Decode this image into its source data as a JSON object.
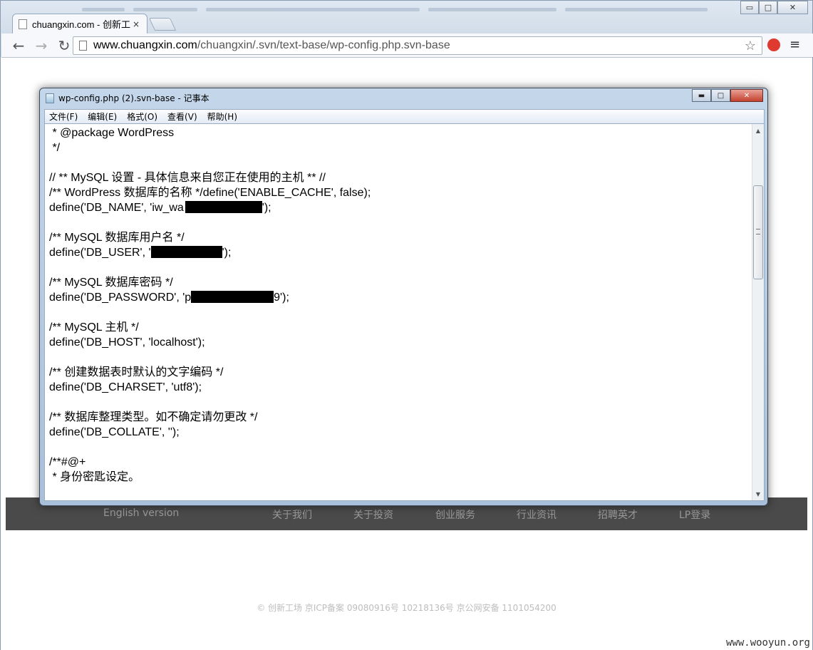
{
  "browser": {
    "tab_title": "chuangxin.com - 创新工",
    "tab_close": "×",
    "url_host": "www.chuangxin.com",
    "url_path": "/chuangxin/.svn/text-base/wp-config.php.svn-base",
    "back_glyph": "←",
    "forward_glyph": "→",
    "reload_glyph": "↻",
    "star_glyph": "☆",
    "menu_glyph": "≡",
    "min_glyph": "▭",
    "max_glyph": "□",
    "close_glyph": "✕"
  },
  "notepad": {
    "title": "wp-config.php (2).svn-base - 记事本",
    "min_glyph": "▬",
    "max_glyph": "□",
    "close_glyph": "✕",
    "menu": [
      "文件(F)",
      "编辑(E)",
      "格式(O)",
      "查看(V)",
      "帮助(H)"
    ],
    "lines": [
      " * @package WordPress",
      " */",
      "",
      "// ** MySQL 设置 - 具体信息来自您正在使用的主机 ** //",
      "/** WordPress 数据库的名称 */define('ENABLE_CACHE', false);",
      "define('DB_NAME', 'iw_wa",
      "",
      "/** MySQL 数据库用户名 */",
      "define('DB_USER', '",
      "",
      "/** MySQL 数据库密码 */",
      "define('DB_PASSWORD', 'p",
      "",
      "/** MySQL 主机 */",
      "define('DB_HOST', 'localhost');",
      "",
      "/** 创建数据表时默认的文字编码 */",
      "define('DB_CHARSET', 'utf8');",
      "",
      "/** 数据库整理类型。如不确定请勿更改 */",
      "define('DB_COLLATE', '');",
      "",
      "/**#@+",
      " * 身份密匙设定。"
    ],
    "line_tails": {
      "db_name": "');",
      "db_user": "');",
      "db_password": "9');"
    },
    "scroll_up": "▲",
    "scroll_down": "▼"
  },
  "page": {
    "footer_links": [
      "English version",
      "关于我们",
      "关于投资",
      "创业服务",
      "行业资讯",
      "招聘英才",
      "LP登录"
    ],
    "copyright": "© 创新工场 京ICP备案 09080916号 10218136号 京公网安备 1101054200",
    "watermark": "www.wooyun.org"
  }
}
